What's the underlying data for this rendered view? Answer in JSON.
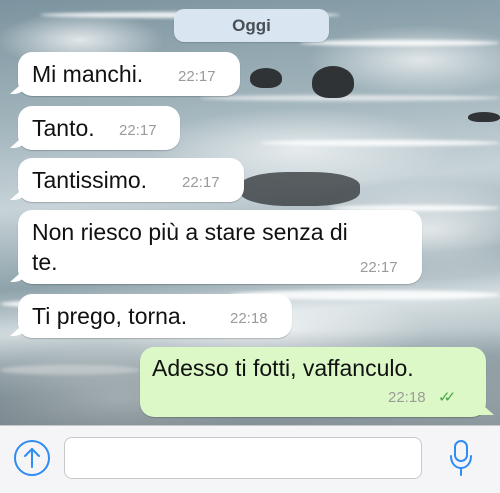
{
  "header": {
    "date_separator": "Oggi"
  },
  "messages": [
    {
      "direction": "incoming",
      "text": "Mi manchi.",
      "time": "22:17"
    },
    {
      "direction": "incoming",
      "text": "Tanto.",
      "time": "22:17"
    },
    {
      "direction": "incoming",
      "text": "Tantissimo.",
      "time": "22:17"
    },
    {
      "direction": "incoming",
      "text_line1": "Non riesco più a stare senza di",
      "text_line2": "te.",
      "time": "22:17"
    },
    {
      "direction": "incoming",
      "text": "Ti prego, torna.",
      "time": "22:18"
    },
    {
      "direction": "outgoing",
      "text": "Adesso ti fotti, vaffanculo.",
      "time": "22:18",
      "status": "read",
      "status_icon": "double-check-icon"
    }
  ],
  "composer": {
    "placeholder": "",
    "value": "",
    "upload_icon": "arrow-up-circle-icon",
    "mic_icon": "microphone-icon"
  },
  "colors": {
    "incoming_bubble": "#ffffff",
    "outgoing_bubble": "#dcf8c6",
    "date_pill": "#d9e6f2",
    "accent": "#2f8cf2",
    "read_ticks": "#4aa54a",
    "timestamp": "#9b9b9b"
  }
}
